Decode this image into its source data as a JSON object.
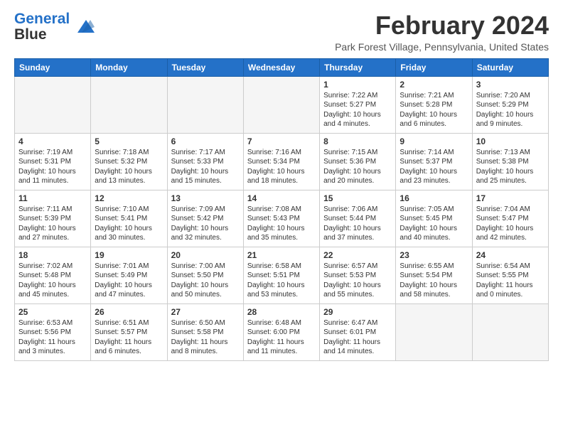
{
  "logo": {
    "line1": "General",
    "line2": "Blue"
  },
  "title": "February 2024",
  "location": "Park Forest Village, Pennsylvania, United States",
  "days_of_week": [
    "Sunday",
    "Monday",
    "Tuesday",
    "Wednesday",
    "Thursday",
    "Friday",
    "Saturday"
  ],
  "weeks": [
    [
      {
        "day": "",
        "info": ""
      },
      {
        "day": "",
        "info": ""
      },
      {
        "day": "",
        "info": ""
      },
      {
        "day": "",
        "info": ""
      },
      {
        "day": "1",
        "info": "Sunrise: 7:22 AM\nSunset: 5:27 PM\nDaylight: 10 hours\nand 4 minutes."
      },
      {
        "day": "2",
        "info": "Sunrise: 7:21 AM\nSunset: 5:28 PM\nDaylight: 10 hours\nand 6 minutes."
      },
      {
        "day": "3",
        "info": "Sunrise: 7:20 AM\nSunset: 5:29 PM\nDaylight: 10 hours\nand 9 minutes."
      }
    ],
    [
      {
        "day": "4",
        "info": "Sunrise: 7:19 AM\nSunset: 5:31 PM\nDaylight: 10 hours\nand 11 minutes."
      },
      {
        "day": "5",
        "info": "Sunrise: 7:18 AM\nSunset: 5:32 PM\nDaylight: 10 hours\nand 13 minutes."
      },
      {
        "day": "6",
        "info": "Sunrise: 7:17 AM\nSunset: 5:33 PM\nDaylight: 10 hours\nand 15 minutes."
      },
      {
        "day": "7",
        "info": "Sunrise: 7:16 AM\nSunset: 5:34 PM\nDaylight: 10 hours\nand 18 minutes."
      },
      {
        "day": "8",
        "info": "Sunrise: 7:15 AM\nSunset: 5:36 PM\nDaylight: 10 hours\nand 20 minutes."
      },
      {
        "day": "9",
        "info": "Sunrise: 7:14 AM\nSunset: 5:37 PM\nDaylight: 10 hours\nand 23 minutes."
      },
      {
        "day": "10",
        "info": "Sunrise: 7:13 AM\nSunset: 5:38 PM\nDaylight: 10 hours\nand 25 minutes."
      }
    ],
    [
      {
        "day": "11",
        "info": "Sunrise: 7:11 AM\nSunset: 5:39 PM\nDaylight: 10 hours\nand 27 minutes."
      },
      {
        "day": "12",
        "info": "Sunrise: 7:10 AM\nSunset: 5:41 PM\nDaylight: 10 hours\nand 30 minutes."
      },
      {
        "day": "13",
        "info": "Sunrise: 7:09 AM\nSunset: 5:42 PM\nDaylight: 10 hours\nand 32 minutes."
      },
      {
        "day": "14",
        "info": "Sunrise: 7:08 AM\nSunset: 5:43 PM\nDaylight: 10 hours\nand 35 minutes."
      },
      {
        "day": "15",
        "info": "Sunrise: 7:06 AM\nSunset: 5:44 PM\nDaylight: 10 hours\nand 37 minutes."
      },
      {
        "day": "16",
        "info": "Sunrise: 7:05 AM\nSunset: 5:45 PM\nDaylight: 10 hours\nand 40 minutes."
      },
      {
        "day": "17",
        "info": "Sunrise: 7:04 AM\nSunset: 5:47 PM\nDaylight: 10 hours\nand 42 minutes."
      }
    ],
    [
      {
        "day": "18",
        "info": "Sunrise: 7:02 AM\nSunset: 5:48 PM\nDaylight: 10 hours\nand 45 minutes."
      },
      {
        "day": "19",
        "info": "Sunrise: 7:01 AM\nSunset: 5:49 PM\nDaylight: 10 hours\nand 47 minutes."
      },
      {
        "day": "20",
        "info": "Sunrise: 7:00 AM\nSunset: 5:50 PM\nDaylight: 10 hours\nand 50 minutes."
      },
      {
        "day": "21",
        "info": "Sunrise: 6:58 AM\nSunset: 5:51 PM\nDaylight: 10 hours\nand 53 minutes."
      },
      {
        "day": "22",
        "info": "Sunrise: 6:57 AM\nSunset: 5:53 PM\nDaylight: 10 hours\nand 55 minutes."
      },
      {
        "day": "23",
        "info": "Sunrise: 6:55 AM\nSunset: 5:54 PM\nDaylight: 10 hours\nand 58 minutes."
      },
      {
        "day": "24",
        "info": "Sunrise: 6:54 AM\nSunset: 5:55 PM\nDaylight: 11 hours\nand 0 minutes."
      }
    ],
    [
      {
        "day": "25",
        "info": "Sunrise: 6:53 AM\nSunset: 5:56 PM\nDaylight: 11 hours\nand 3 minutes."
      },
      {
        "day": "26",
        "info": "Sunrise: 6:51 AM\nSunset: 5:57 PM\nDaylight: 11 hours\nand 6 minutes."
      },
      {
        "day": "27",
        "info": "Sunrise: 6:50 AM\nSunset: 5:58 PM\nDaylight: 11 hours\nand 8 minutes."
      },
      {
        "day": "28",
        "info": "Sunrise: 6:48 AM\nSunset: 6:00 PM\nDaylight: 11 hours\nand 11 minutes."
      },
      {
        "day": "29",
        "info": "Sunrise: 6:47 AM\nSunset: 6:01 PM\nDaylight: 11 hours\nand 14 minutes."
      },
      {
        "day": "",
        "info": ""
      },
      {
        "day": "",
        "info": ""
      }
    ]
  ]
}
